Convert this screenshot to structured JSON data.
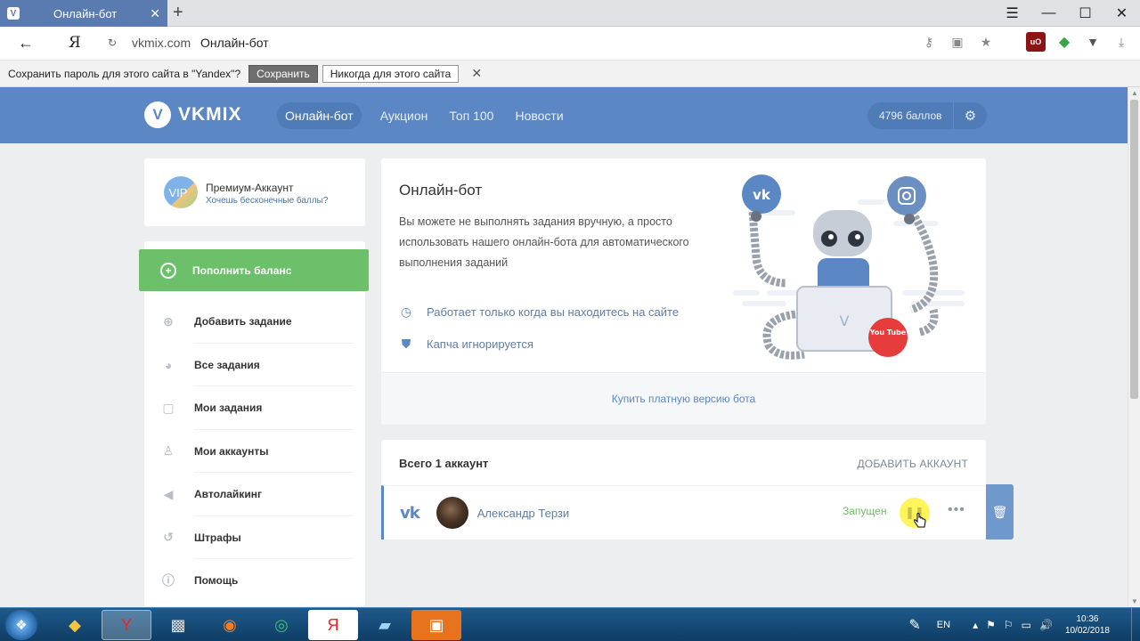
{
  "browser": {
    "tab_title": "Онлайн-бот",
    "tab_close": "✕",
    "new_tab": "+",
    "address_domain": "vkmix.com",
    "address_title": "Онлайн-бот",
    "logo_letter": "Я",
    "window_buttons": [
      "☰",
      "—",
      "☐",
      "✕"
    ]
  },
  "password_bar": {
    "message": "Сохранить пароль для этого сайта в \"Yandex\"?",
    "save_label": "Сохранить",
    "never_label": "Никогда для этого сайта",
    "close": "✕"
  },
  "header": {
    "logo_letter": "V",
    "logo_text": "VKMIX",
    "nav": [
      {
        "label": "Онлайн-бот",
        "active": true
      },
      {
        "label": "Аукцион",
        "active": false
      },
      {
        "label": "Топ 100",
        "active": false
      },
      {
        "label": "Новости",
        "active": false
      }
    ],
    "balance": "4796 баллов"
  },
  "premium": {
    "badge": "VIP",
    "title": "Премиум-Аккаунт",
    "subtitle": "Хочешь бесконечные баллы?"
  },
  "sidebar": {
    "topup_label": "Пополнить баланс",
    "items": [
      {
        "label": "Добавить задание",
        "icon": "add-task-icon"
      },
      {
        "label": "Все задания",
        "icon": "all-tasks-icon"
      },
      {
        "label": "Мои задания",
        "icon": "my-tasks-icon"
      },
      {
        "label": "Мои аккаунты",
        "icon": "user-icon"
      },
      {
        "label": "Автолайкинг",
        "icon": "megaphone-icon"
      },
      {
        "label": "Штрафы",
        "icon": "penalty-icon"
      },
      {
        "label": "Помощь",
        "icon": "info-icon"
      }
    ]
  },
  "bot": {
    "title": "Онлайн-бот",
    "description": "Вы можете не выполнять задания вручную, а просто использовать нашего онлайн-бота для автоматического выполнения заданий",
    "feature1": "Работает только когда вы находитесь на сайте",
    "feature2": "Капча игнорируется",
    "buy_label": "Купить платную версию бота",
    "youtube_label": "You Tube"
  },
  "accounts": {
    "title": "Всего 1 аккаунт",
    "add_label": "ДОБАВИТЬ АККАУНТ",
    "rows": [
      {
        "network": "VK",
        "name": "Александр Терзи",
        "status": "Запущен"
      }
    ]
  },
  "taskbar": {
    "lang": "EN",
    "time": "10:36",
    "date": "10/02/2018"
  },
  "colors": {
    "header_blue": "#5b88c4",
    "green": "#6cc06a",
    "status_green": "#6cbf60",
    "highlight_yellow": "#fff45a"
  }
}
